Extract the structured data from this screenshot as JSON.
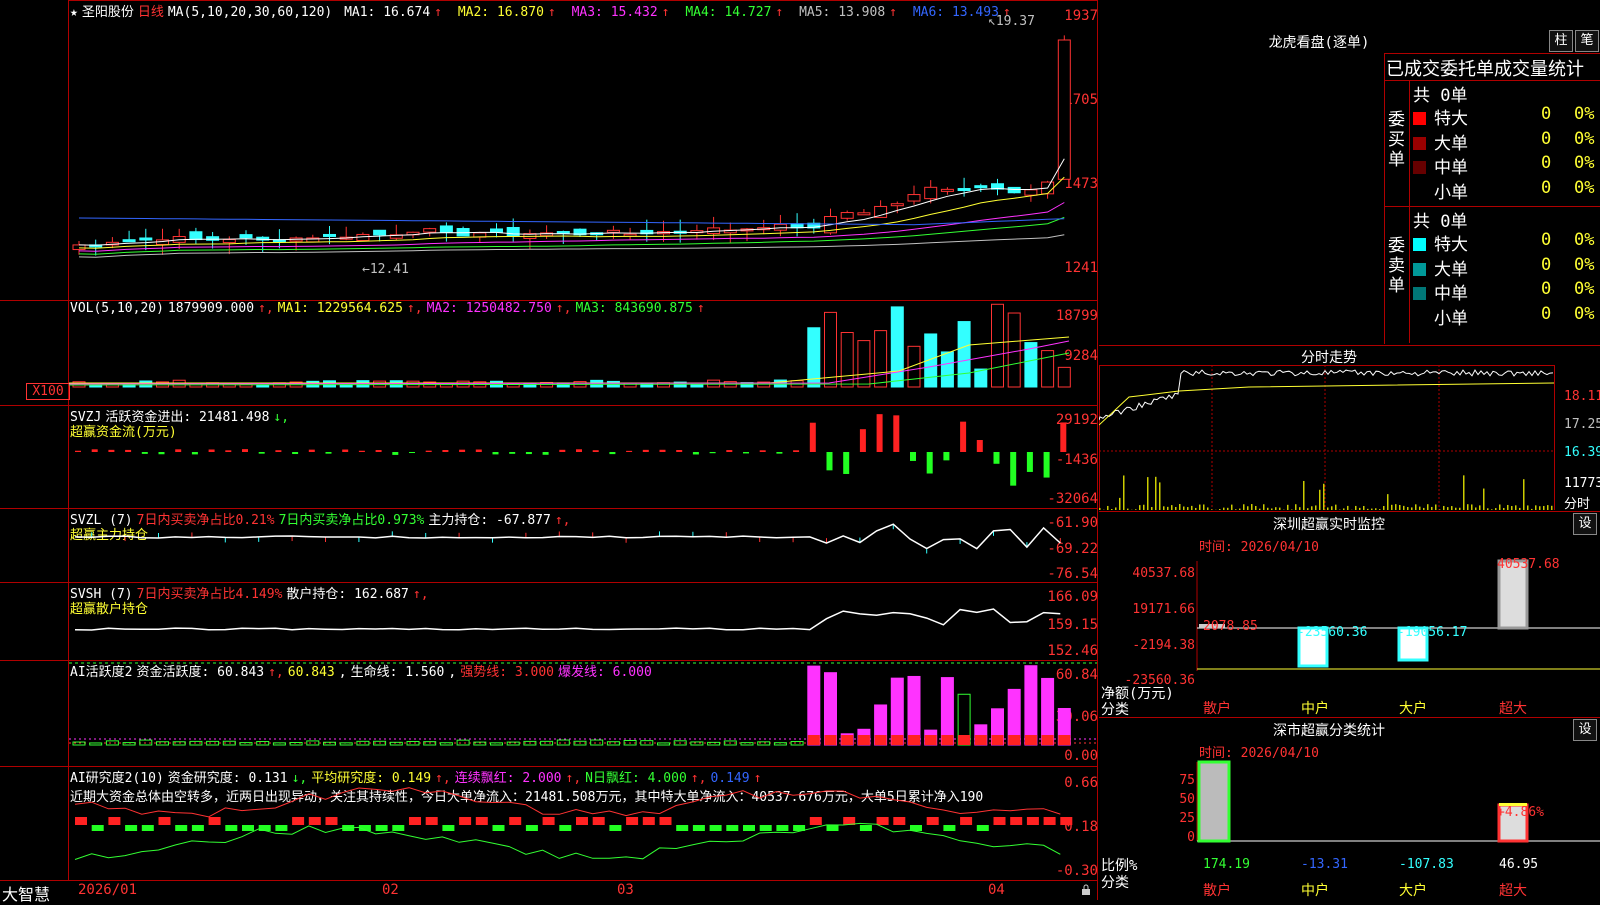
{
  "stock": {
    "name": "圣阳股份",
    "period": "日线",
    "ma_label": "MA(5,10,20,30,60,120)",
    "star": "★"
  },
  "price_panel": {
    "ma": [
      {
        "label": "MA1: 16.674",
        "arrow": "↑",
        "color": "#ffffff"
      },
      {
        "label": "MA2: 16.870",
        "arrow": "↑",
        "color": "#ffff33"
      },
      {
        "label": "MA3: 15.432",
        "arrow": "↑",
        "color": "#ff33ff"
      },
      {
        "label": "MA4: 14.727",
        "arrow": "↑",
        "color": "#33ff33"
      },
      {
        "label": "MA5: 13.908",
        "arrow": "↑",
        "color": "#c0c0c0"
      },
      {
        "label": "MA6: 13.493",
        "arrow": "↑",
        "color": "#3366ff"
      }
    ],
    "yticks": [
      "1937",
      "1705",
      "1473",
      "1241"
    ],
    "high_marker": "19.37",
    "low_marker": "12.41"
  },
  "vol_panel": {
    "title": "VOL(5,10,20)",
    "value": "1879909.000",
    "ma1": "MA1: 1229564.625",
    "ma2": "MA2: 1250482.750",
    "ma3": "MA3: 843690.875",
    "yticks": [
      "18799",
      "9284"
    ],
    "unit": "X100"
  },
  "svzj_panel": {
    "title": "SVZJ",
    "desc": "活跃资金进出: 21481.498",
    "arrow": "↓,",
    "sub": "超赢资金流(万元)",
    "yticks": [
      "29192",
      "-1436",
      "-32064"
    ]
  },
  "svzl_panel": {
    "title": "SVZL (7)",
    "t1": "7日内买卖净占比0.21%",
    "t2": "7日内买卖净占比0.973%",
    "t3": "主力持仓: -67.877",
    "arrow": "↑,",
    "sub": "超赢主力持仓",
    "yticks": [
      "-61.90",
      "-69.22",
      "-76.54"
    ]
  },
  "svsh_panel": {
    "title": "SVSH (7)",
    "t1": "7日内买卖净占比4.149%",
    "t2": "散户持仓: 162.687",
    "arrow": "↑,",
    "sub": "超赢散户持仓",
    "yticks": [
      "166.09",
      "159.15",
      "152.46"
    ]
  },
  "ai_active": {
    "title": "AI活跃度2",
    "t1": "资金活跃度: 60.843",
    "t2": "60.843",
    "t3": "生命线: 1.560",
    "t4": "强势线: 3.000",
    "t5": "爆发线: 6.000",
    "yticks": [
      "60.84",
      "30.06",
      "0.00"
    ]
  },
  "ai_research": {
    "title": "AI研究度2(10)",
    "t1": "资金研究度: 0.131",
    "t2": "平均研究度: 0.149",
    "t3": "连续飘红: 2.000",
    "t4": "N日飘红: 4.000",
    "t5": "0.149",
    "comment": "近期大资金总体由空转多，近两日出现异动，关注其持续性，今日大单净流入：21481.508万元，其中特大单净流入：40537.676万元，大单5日累计净入190",
    "yticks": [
      "0.66",
      "0.18",
      "-0.30"
    ]
  },
  "xaxis": {
    "brand": "大智慧",
    "labels": [
      "2026/01",
      "02",
      "03",
      "04"
    ]
  },
  "longhu": {
    "title": "龙虎看盘(逐单)",
    "btn_zhu": "柱",
    "btn_bi": "笔",
    "tabs": "已成交委托单成交量统计",
    "buy_label": "委买单",
    "sell_label": "委卖单",
    "buy_total": "共 0单",
    "sell_total": "共 0单",
    "buy_rows": [
      {
        "name": "特大",
        "count": "0",
        "pct": "0%",
        "color": "#ff0000"
      },
      {
        "name": "大单",
        "count": "0",
        "pct": "0%",
        "color": "#990000"
      },
      {
        "name": "中单",
        "count": "0",
        "pct": "0%",
        "color": "#660000"
      },
      {
        "name": "小单",
        "count": "0",
        "pct": "0%",
        "color": "#000000"
      }
    ],
    "sell_rows": [
      {
        "name": "特大",
        "count": "0",
        "pct": "0%",
        "color": "#00ffff"
      },
      {
        "name": "大单",
        "count": "0",
        "pct": "0%",
        "color": "#009999"
      },
      {
        "name": "中单",
        "count": "0",
        "pct": "0%",
        "color": "#007777"
      },
      {
        "name": "小单",
        "count": "0",
        "pct": "0%",
        "color": "#000000"
      }
    ]
  },
  "fenshi": {
    "title": "分时走势",
    "yticks": [
      "18.11",
      "17.25",
      "16.39"
    ],
    "vol": "11773",
    "vol_label": "分时"
  },
  "monitor": {
    "title": "深圳超赢实时监控",
    "btn": "设",
    "time": "时间: 2026/04/10",
    "yticks": [
      "40537.68",
      "19171.66",
      "-2194.38",
      "-23560.36"
    ],
    "ylabel": "净额(万元)",
    "ylabel2": "分类",
    "categories": [
      "散户",
      "中户",
      "大户",
      "超大"
    ],
    "values": [
      "2078.85",
      "-23560.36",
      "-19056.17",
      "40537.68"
    ]
  },
  "classify": {
    "title": "深市超赢分类统计",
    "btn": "设",
    "time": "时间: 2026/04/10",
    "yticks": [
      "75",
      "50",
      "25",
      "0"
    ],
    "ylabel": "比例%",
    "ylabel2": "分类",
    "categories": [
      "散户",
      "中户",
      "大户",
      "超大"
    ],
    "values": [
      "174.19",
      "-13.31",
      "-107.83",
      "46.95"
    ],
    "pct_label": "+4.86%"
  }
}
